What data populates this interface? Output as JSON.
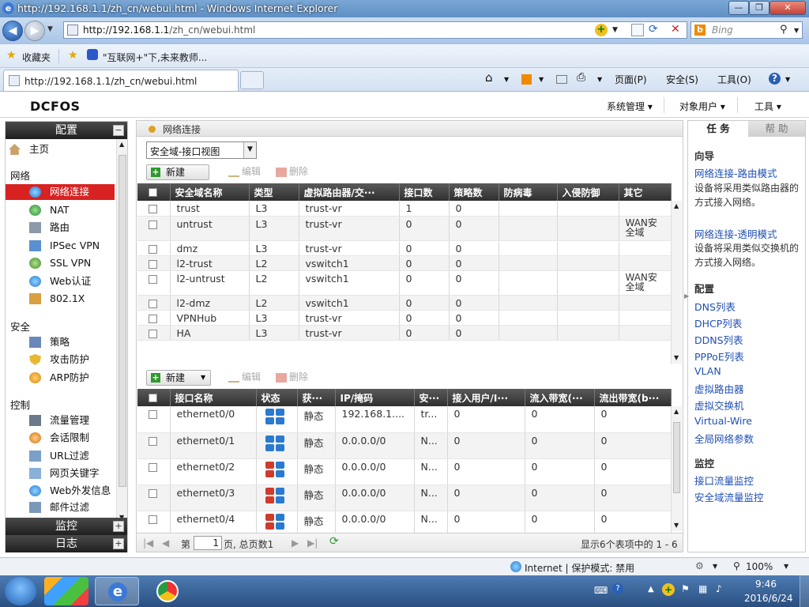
{
  "browser": {
    "window_title": "http://192.168.1.1/zh_cn/webui.html - Windows Internet Explorer",
    "address_host": "http://192.168.1.1",
    "address_path": "/zh_cn/webui.html",
    "search_placeholder": "Bing",
    "favorites_label": "收藏夹",
    "favorite_item": "\"互联网+\"下,未来教师...",
    "tab_title": "http://192.168.1.1/zh_cn/webui.html",
    "commands": [
      "页面(P)",
      "安全(S)",
      "工具(O)"
    ]
  },
  "app": {
    "logo": "DCFOS",
    "top_menu": [
      "系统管理",
      "对象用户",
      "工具"
    ]
  },
  "sidebar": {
    "config_header": "配置",
    "home": "主页",
    "groups": {
      "network": "网络",
      "security": "安全",
      "control": "控制"
    },
    "network_items": [
      "网络连接",
      "NAT",
      "路由",
      "IPSec VPN",
      "SSL VPN",
      "Web认证",
      "802.1X"
    ],
    "security_items": [
      "策略",
      "攻击防护",
      "ARP防护"
    ],
    "control_items": [
      "流量管理",
      "会话限制",
      "URL过滤",
      "网页关键字",
      "Web外发信息",
      "邮件过滤"
    ],
    "monitor_header": "监控",
    "log_header": "日志"
  },
  "main": {
    "panel_title": "网络连接",
    "view_select": "安全域-接口视图",
    "toolbar1": {
      "new": "新建",
      "edit": "编辑",
      "delete": "删除"
    },
    "zones_columns": [
      "安全域名称",
      "类型",
      "虚拟路由器/交···",
      "接口数",
      "策略数",
      "防病毒",
      "入侵防御",
      "其它"
    ],
    "zones": [
      {
        "name": "trust",
        "type": "L3",
        "vr": "trust-vr",
        "ifaces": "1",
        "policies": "0",
        "other": ""
      },
      {
        "name": "untrust",
        "type": "L3",
        "vr": "trust-vr",
        "ifaces": "0",
        "policies": "0",
        "other": "WAN安全域"
      },
      {
        "name": "dmz",
        "type": "L3",
        "vr": "trust-vr",
        "ifaces": "0",
        "policies": "0",
        "other": ""
      },
      {
        "name": "l2-trust",
        "type": "L2",
        "vr": "vswitch1",
        "ifaces": "0",
        "policies": "0",
        "other": ""
      },
      {
        "name": "l2-untrust",
        "type": "L2",
        "vr": "vswitch1",
        "ifaces": "0",
        "policies": "0",
        "other": "WAN安全域"
      },
      {
        "name": "l2-dmz",
        "type": "L2",
        "vr": "vswitch1",
        "ifaces": "0",
        "policies": "0",
        "other": ""
      },
      {
        "name": "VPNHub",
        "type": "L3",
        "vr": "trust-vr",
        "ifaces": "0",
        "policies": "0",
        "other": ""
      },
      {
        "name": "HA",
        "type": "L3",
        "vr": "trust-vr",
        "ifaces": "0",
        "policies": "0",
        "other": ""
      }
    ],
    "toolbar2": {
      "new": "新建",
      "edit": "编辑",
      "delete": "删除"
    },
    "iface_columns": [
      "接口名称",
      "状态",
      "获···",
      "IP/掩码",
      "安···",
      "接入用户/I···",
      "流入带宽(···",
      "流出带宽(b···"
    ],
    "interfaces": [
      {
        "name": "ethernet0/0",
        "mode": "静态",
        "ip": "192.168.1....",
        "sec": "tr...",
        "users": "0",
        "in": "0",
        "out": "0",
        "up": true
      },
      {
        "name": "ethernet0/1",
        "mode": "静态",
        "ip": "0.0.0.0/0",
        "sec": "N...",
        "users": "0",
        "in": "0",
        "out": "0",
        "up": true
      },
      {
        "name": "ethernet0/2",
        "mode": "静态",
        "ip": "0.0.0.0/0",
        "sec": "N...",
        "users": "0",
        "in": "0",
        "out": "0",
        "up": false
      },
      {
        "name": "ethernet0/3",
        "mode": "静态",
        "ip": "0.0.0.0/0",
        "sec": "N...",
        "users": "0",
        "in": "0",
        "out": "0",
        "up": false
      },
      {
        "name": "ethernet0/4",
        "mode": "静态",
        "ip": "0.0.0.0/0",
        "sec": "N...",
        "users": "0",
        "in": "0",
        "out": "0",
        "up": false
      }
    ],
    "pager": {
      "prefix": "第",
      "page": "1",
      "suffix": "页, 总页数1",
      "summary": "显示6个表项中的 1 - 6"
    }
  },
  "right": {
    "tab_tasks": "任 务",
    "tab_help": "帮 助",
    "wizard_header": "向导",
    "wizard_link1": "网络连接-路由模式",
    "wizard_desc1": "设备将采用类似路由器的方式接入网络。",
    "wizard_link2": "网络连接-透明模式",
    "wizard_desc2": "设备将采用类似交换机的方式接入网络。",
    "config_header": "配置",
    "config_links": [
      "DNS列表",
      "DHCP列表",
      "DDNS列表",
      "PPPoE列表",
      "VLAN",
      "虚拟路由器",
      "虚拟交换机",
      "Virtual-Wire",
      "全局网络参数"
    ],
    "monitor_header": "监控",
    "monitor_links": [
      "接口流量监控",
      "安全域流量监控"
    ]
  },
  "status": {
    "zone": "Internet | 保护模式: 禁用",
    "zoom": "100%"
  },
  "taskbar": {
    "time": "9:46",
    "date": "2016/6/24"
  },
  "colors": {
    "active_nav": "#d82222",
    "link": "#1f4fb4",
    "header_dark": "#2f2f2f"
  }
}
